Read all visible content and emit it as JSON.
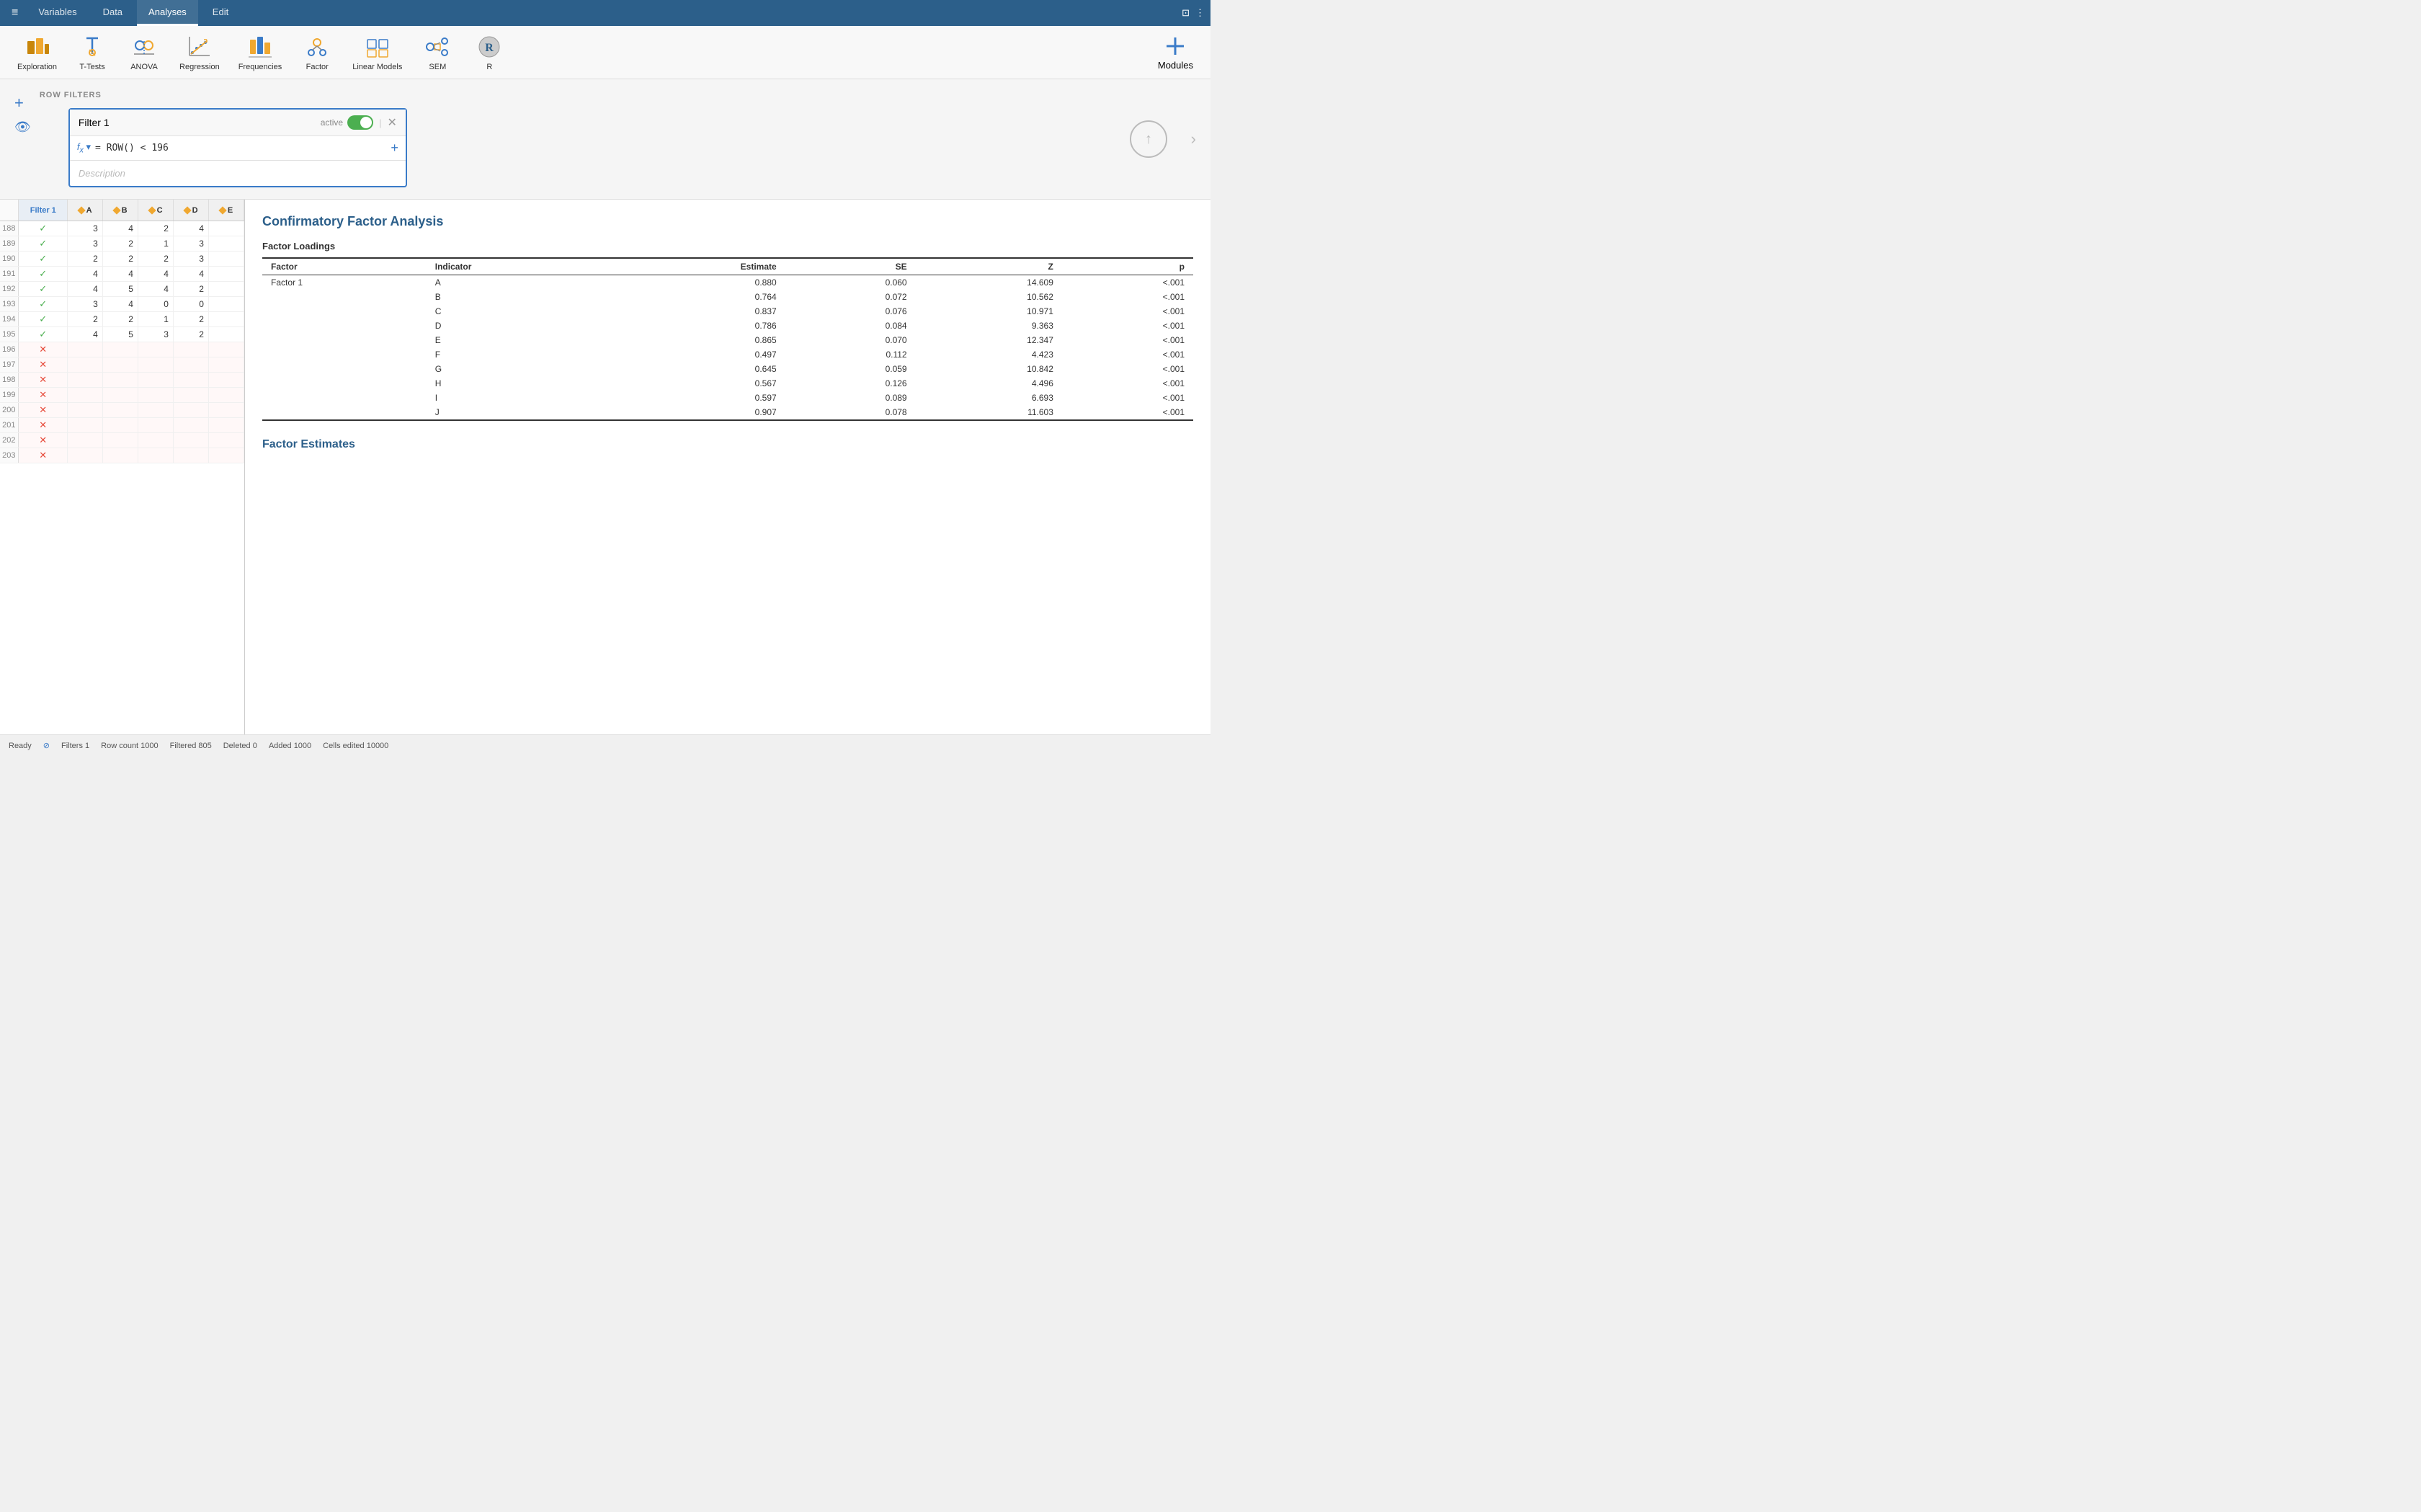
{
  "nav": {
    "hamburger": "≡",
    "tabs": [
      "Variables",
      "Data",
      "Analyses",
      "Edit"
    ],
    "active_tab": "Analyses",
    "icons_right": [
      "⊡",
      "⋮"
    ]
  },
  "toolbar": {
    "items": [
      {
        "id": "exploration",
        "label": "Exploration",
        "icon": "exploration"
      },
      {
        "id": "t-tests",
        "label": "T-Tests",
        "icon": "ttests"
      },
      {
        "id": "anova",
        "label": "ANOVA",
        "icon": "anova"
      },
      {
        "id": "regression",
        "label": "Regression",
        "icon": "regression"
      },
      {
        "id": "frequencies",
        "label": "Frequencies",
        "icon": "frequencies"
      },
      {
        "id": "factor",
        "label": "Factor",
        "icon": "factor"
      },
      {
        "id": "linear-models",
        "label": "Linear Models",
        "icon": "linearmodels"
      },
      {
        "id": "sem",
        "label": "SEM",
        "icon": "sem"
      },
      {
        "id": "r",
        "label": "R",
        "icon": "r"
      }
    ],
    "modules_label": "Modules"
  },
  "filter_panel": {
    "row_filters_label": "ROW FILTERS",
    "filter_card": {
      "title": "Filter 1",
      "active_label": "active",
      "formula": "= ROW()  <  196",
      "description_placeholder": "Description"
    }
  },
  "data_grid": {
    "columns": [
      "Filter 1",
      "A",
      "B",
      "C",
      "D",
      "E"
    ],
    "rows": [
      {
        "num": 188,
        "filter": "check",
        "A": 3,
        "B": 4,
        "C": 2,
        "D": 4,
        "E": ""
      },
      {
        "num": 189,
        "filter": "check",
        "A": 3,
        "B": 2,
        "C": 1,
        "D": 3,
        "E": ""
      },
      {
        "num": 190,
        "filter": "check",
        "A": 2,
        "B": 2,
        "C": 2,
        "D": 3,
        "E": ""
      },
      {
        "num": 191,
        "filter": "check",
        "A": 4,
        "B": 4,
        "C": 4,
        "D": 4,
        "E": ""
      },
      {
        "num": 192,
        "filter": "check",
        "A": 4,
        "B": 5,
        "C": 4,
        "D": 2,
        "E": ""
      },
      {
        "num": 193,
        "filter": "check",
        "A": 3,
        "B": 4,
        "C": 0,
        "D": 0,
        "E": ""
      },
      {
        "num": 194,
        "filter": "check",
        "A": 2,
        "B": 2,
        "C": 1,
        "D": 2,
        "E": ""
      },
      {
        "num": 195,
        "filter": "check",
        "A": 4,
        "B": 5,
        "C": 3,
        "D": 2,
        "E": ""
      },
      {
        "num": 196,
        "filter": "x",
        "A": "",
        "B": "",
        "C": "",
        "D": "",
        "E": ""
      },
      {
        "num": 197,
        "filter": "x",
        "A": "",
        "B": "",
        "C": "",
        "D": "",
        "E": ""
      },
      {
        "num": 198,
        "filter": "x",
        "A": "",
        "B": "",
        "C": "",
        "D": "",
        "E": ""
      },
      {
        "num": 199,
        "filter": "x",
        "A": "",
        "B": "",
        "C": "",
        "D": "",
        "E": ""
      },
      {
        "num": 200,
        "filter": "x",
        "A": "",
        "B": "",
        "C": "",
        "D": "",
        "E": ""
      },
      {
        "num": 201,
        "filter": "x",
        "A": "",
        "B": "",
        "C": "",
        "D": "",
        "E": ""
      },
      {
        "num": 202,
        "filter": "x",
        "A": "",
        "B": "",
        "C": "",
        "D": "",
        "E": ""
      },
      {
        "num": 203,
        "filter": "x",
        "A": "",
        "B": "",
        "C": "",
        "D": "",
        "E": ""
      }
    ]
  },
  "results": {
    "cfa_title": "Confirmatory Factor Analysis",
    "factor_loadings_label": "Factor Loadings",
    "table_headers": [
      "Factor",
      "Indicator",
      "Estimate",
      "SE",
      "Z",
      "p"
    ],
    "factor_name": "Factor 1",
    "loadings": [
      {
        "indicator": "A",
        "estimate": "0.880",
        "se": "0.060",
        "z": "14.609",
        "p": "<.001"
      },
      {
        "indicator": "B",
        "estimate": "0.764",
        "se": "0.072",
        "z": "10.562",
        "p": "<.001"
      },
      {
        "indicator": "C",
        "estimate": "0.837",
        "se": "0.076",
        "z": "10.971",
        "p": "<.001"
      },
      {
        "indicator": "D",
        "estimate": "0.786",
        "se": "0.084",
        "z": "9.363",
        "p": "<.001"
      },
      {
        "indicator": "E",
        "estimate": "0.865",
        "se": "0.070",
        "z": "12.347",
        "p": "<.001"
      },
      {
        "indicator": "F",
        "estimate": "0.497",
        "se": "0.112",
        "z": "4.423",
        "p": "<.001"
      },
      {
        "indicator": "G",
        "estimate": "0.645",
        "se": "0.059",
        "z": "10.842",
        "p": "<.001"
      },
      {
        "indicator": "H",
        "estimate": "0.567",
        "se": "0.126",
        "z": "4.496",
        "p": "<.001"
      },
      {
        "indicator": "I",
        "estimate": "0.597",
        "se": "0.089",
        "z": "6.693",
        "p": "<.001"
      },
      {
        "indicator": "J",
        "estimate": "0.907",
        "se": "0.078",
        "z": "11.603",
        "p": "<.001"
      }
    ],
    "factor_estimates_title": "Factor Estimates"
  },
  "status_bar": {
    "ready": "Ready",
    "filters_label": "Filters 1",
    "row_count": "Row count 1000",
    "filtered": "Filtered 805",
    "deleted": "Deleted 0",
    "added": "Added 1000",
    "cells_edited": "Cells edited 10000"
  }
}
